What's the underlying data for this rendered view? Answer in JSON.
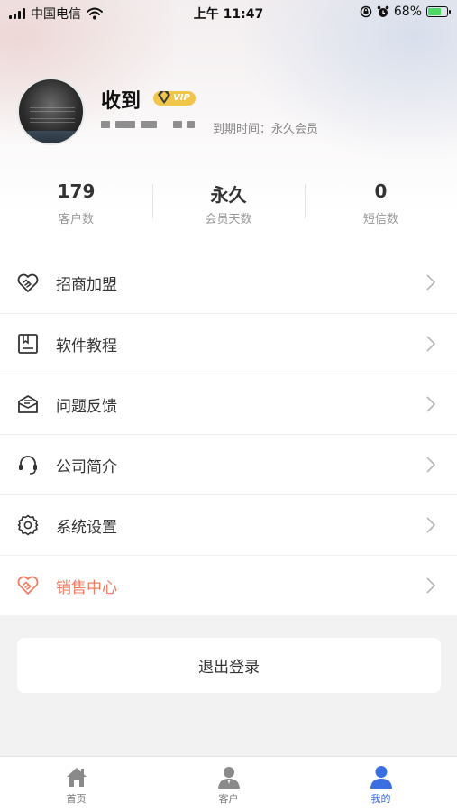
{
  "status_bar": {
    "carrier": "中国电信",
    "time": "上午 11:47",
    "battery": "68%",
    "battery_level": 0.68
  },
  "profile": {
    "name": "收到",
    "vip_label": "VIP",
    "expiry_label": "到期时间：",
    "expiry_value": "永久会员"
  },
  "stats": [
    {
      "value": "179",
      "label": "客户数"
    },
    {
      "value": "永久",
      "label": "会员天数"
    },
    {
      "value": "0",
      "label": "短信数"
    }
  ],
  "menu": {
    "items": [
      {
        "label": "招商加盟",
        "icon": "handshake-heart-icon"
      },
      {
        "label": "软件教程",
        "icon": "bookmark-box-icon"
      },
      {
        "label": "问题反馈",
        "icon": "mail-icon"
      },
      {
        "label": "公司简介",
        "icon": "headset-icon"
      },
      {
        "label": "系统设置",
        "icon": "gear-icon"
      },
      {
        "label": "销售中心",
        "icon": "handshake-heart-icon",
        "color": "#ef7d63"
      }
    ]
  },
  "logout_label": "退出登录",
  "tabs": [
    {
      "label": "首页",
      "icon": "home-icon"
    },
    {
      "label": "客户",
      "icon": "person-icon"
    },
    {
      "label": "我的",
      "icon": "user-icon",
      "active": true
    }
  ],
  "colors": {
    "accent_blue": "#3a6fe2",
    "accent_orange": "#ef7d63",
    "vip_gold": "#f0c54a"
  }
}
